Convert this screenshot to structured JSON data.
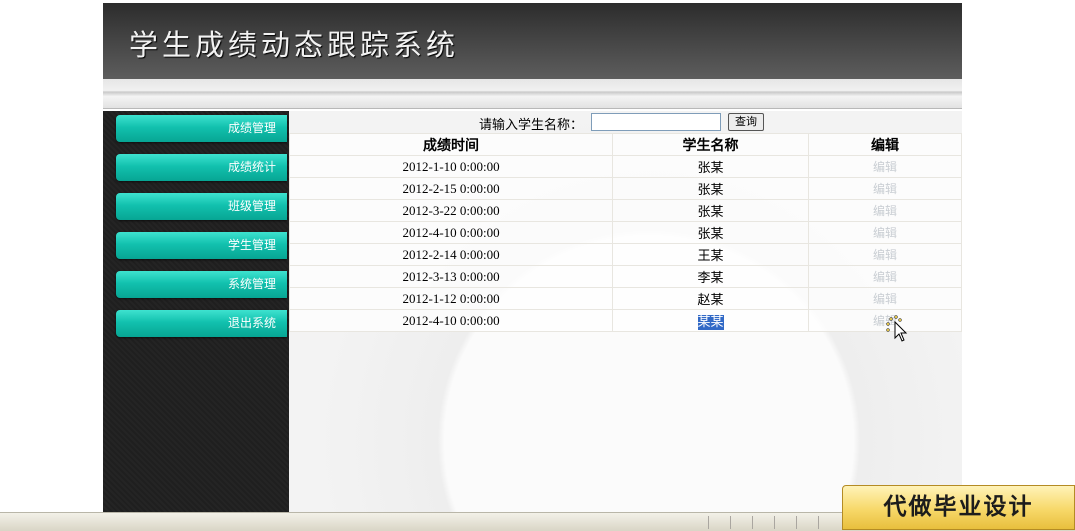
{
  "header": {
    "title": "学生成绩动态跟踪系统"
  },
  "sidebar": {
    "items": [
      {
        "label": "成绩管理"
      },
      {
        "label": "成绩统计"
      },
      {
        "label": "班级管理"
      },
      {
        "label": "学生管理"
      },
      {
        "label": "系统管理"
      },
      {
        "label": "退出系统"
      }
    ]
  },
  "search": {
    "label": "请输入学生名称：",
    "value": "",
    "button_label": "查询"
  },
  "table": {
    "headers": [
      "成绩时间",
      "学生名称",
      "编辑"
    ],
    "rows": [
      {
        "time": "2012-1-10 0:00:00",
        "name": "张某",
        "edit": "编辑"
      },
      {
        "time": "2012-2-15 0:00:00",
        "name": "张某",
        "edit": "编辑"
      },
      {
        "time": "2012-3-22 0:00:00",
        "name": "张某",
        "edit": "编辑"
      },
      {
        "time": "2012-4-10 0:00:00",
        "name": "张某",
        "edit": "编辑"
      },
      {
        "time": "2012-2-14 0:00:00",
        "name": "王某",
        "edit": "编辑"
      },
      {
        "time": "2012-3-13 0:00:00",
        "name": "李某",
        "edit": "编辑"
      },
      {
        "time": "2012-1-12 0:00:00",
        "name": "赵某",
        "edit": "编辑"
      },
      {
        "time": "2012-4-10 0:00:00",
        "name": "某某",
        "edit": "编辑"
      }
    ]
  },
  "promo": {
    "label": "代做毕业设计"
  },
  "colors": {
    "sidebar_button": "#12c1ae",
    "sidebar_bg": "#1f1f1f",
    "header_bg": "#3e3e3e",
    "selection": "#3169c6",
    "edit_link": "#c9ced3"
  },
  "icons": {
    "cursor": "arrow-busy-cursor-icon"
  }
}
